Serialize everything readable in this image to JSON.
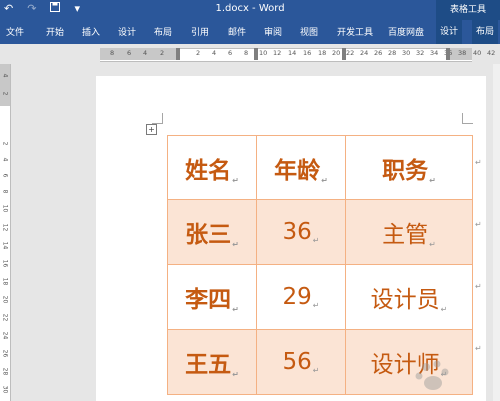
{
  "window": {
    "title": "1.docx - Word",
    "context_tools": "表格工具"
  },
  "qat": {
    "undo": "↶",
    "redo": "↷",
    "save": "💾",
    "customize": "▾"
  },
  "ribbon": {
    "tabs": [
      "文件",
      "开始",
      "插入",
      "设计",
      "布局",
      "引用",
      "邮件",
      "审阅",
      "视图",
      "开发工具",
      "百度网盘"
    ],
    "context_tabs": [
      "设计",
      "布局"
    ]
  },
  "ruler": {
    "h_numbers": [
      "8",
      "6",
      "4",
      "2",
      "2",
      "4",
      "6",
      "8",
      "10",
      "12",
      "14",
      "16",
      "18",
      "20",
      "22",
      "24",
      "26",
      "28",
      "30",
      "32",
      "34",
      "36",
      "38",
      "40",
      "42"
    ],
    "v_numbers": [
      "4",
      "2",
      "2",
      "4",
      "6",
      "8",
      "10",
      "12",
      "14",
      "16",
      "18",
      "20",
      "22",
      "24",
      "26",
      "28",
      "30"
    ]
  },
  "table": {
    "header": [
      "姓名",
      "年龄",
      "职务"
    ],
    "rows": [
      [
        "张三",
        "36",
        "主管"
      ],
      [
        "李四",
        "29",
        "设计员"
      ],
      [
        "王五",
        "56",
        "设计师"
      ]
    ]
  },
  "colors": {
    "accent": "#2b579a",
    "table_text": "#c55a11",
    "table_border": "#f4b183",
    "table_fill": "#fbe4d5"
  }
}
